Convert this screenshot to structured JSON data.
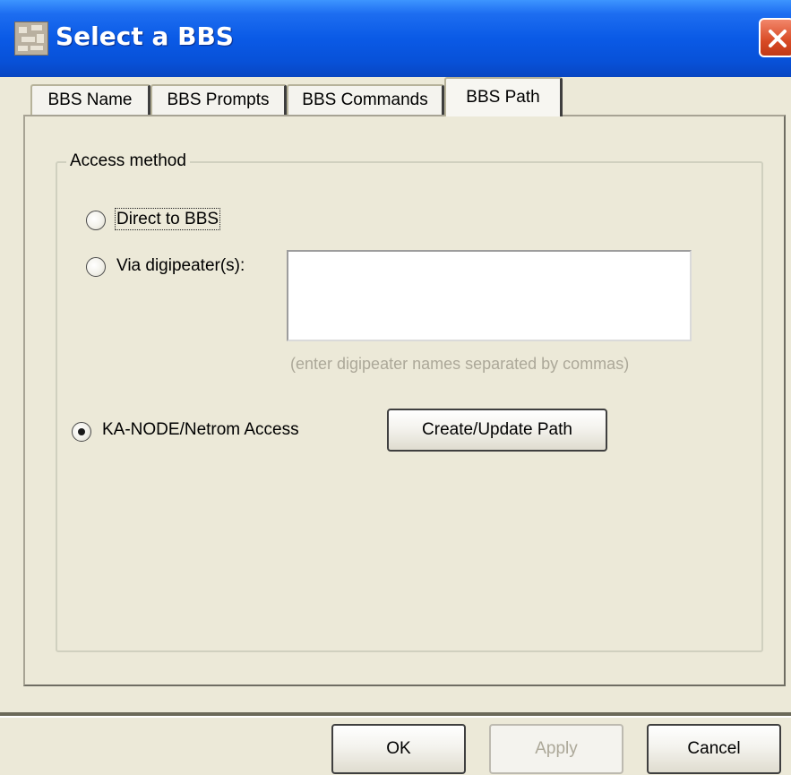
{
  "window": {
    "title": "Select a BBS",
    "app_icon": "app-icon",
    "close_icon": "close-icon"
  },
  "tabs": [
    {
      "label": "BBS Name",
      "active": false
    },
    {
      "label": "BBS Prompts",
      "active": false
    },
    {
      "label": "BBS Commands",
      "active": false
    },
    {
      "label": "BBS Path",
      "active": true
    }
  ],
  "access_method": {
    "legend": "Access method",
    "options": {
      "direct": {
        "label": "Direct to BBS",
        "checked": false
      },
      "digipeater": {
        "label": "Via digipeater(s):",
        "checked": false
      },
      "netrom": {
        "label": "KA-NODE/Netrom Access",
        "checked": true
      }
    },
    "digipeater_value": "",
    "digipeater_hint": "(enter digipeater names separated by commas)",
    "create_path_label": "Create/Update Path"
  },
  "footer": {
    "ok_label": "OK",
    "apply_label": "Apply",
    "cancel_label": "Cancel",
    "apply_enabled": false
  }
}
